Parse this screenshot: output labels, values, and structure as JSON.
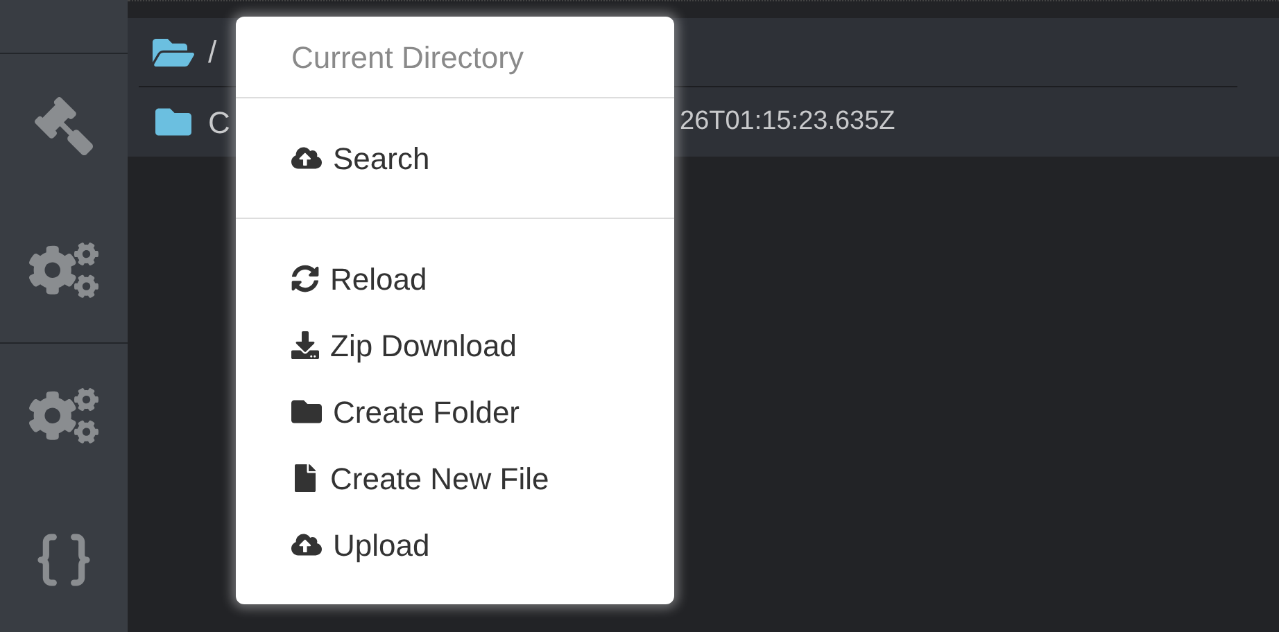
{
  "sidebar": {
    "items": [
      {
        "kind": "hammer",
        "section_start": true
      },
      {
        "kind": "gears",
        "section_start": false
      },
      {
        "kind": "gears",
        "section_start": true
      },
      {
        "kind": "braces",
        "section_start": false
      }
    ]
  },
  "file_list": {
    "rows": [
      {
        "kind": "open-folder",
        "name": "/"
      },
      {
        "kind": "folder",
        "name": "C",
        "modified": "26T01:15:23.635Z"
      }
    ]
  },
  "context_menu": {
    "header": "Current Directory",
    "sections": [
      [
        {
          "kind": "cloud-upload",
          "label": "Search"
        }
      ],
      [
        {
          "kind": "reload",
          "label": "Reload"
        },
        {
          "kind": "download",
          "label": "Zip Download"
        },
        {
          "kind": "folder",
          "label": "Create Folder"
        },
        {
          "kind": "file",
          "label": "Create New File"
        },
        {
          "kind": "cloud-upload",
          "label": "Upload"
        }
      ]
    ]
  }
}
